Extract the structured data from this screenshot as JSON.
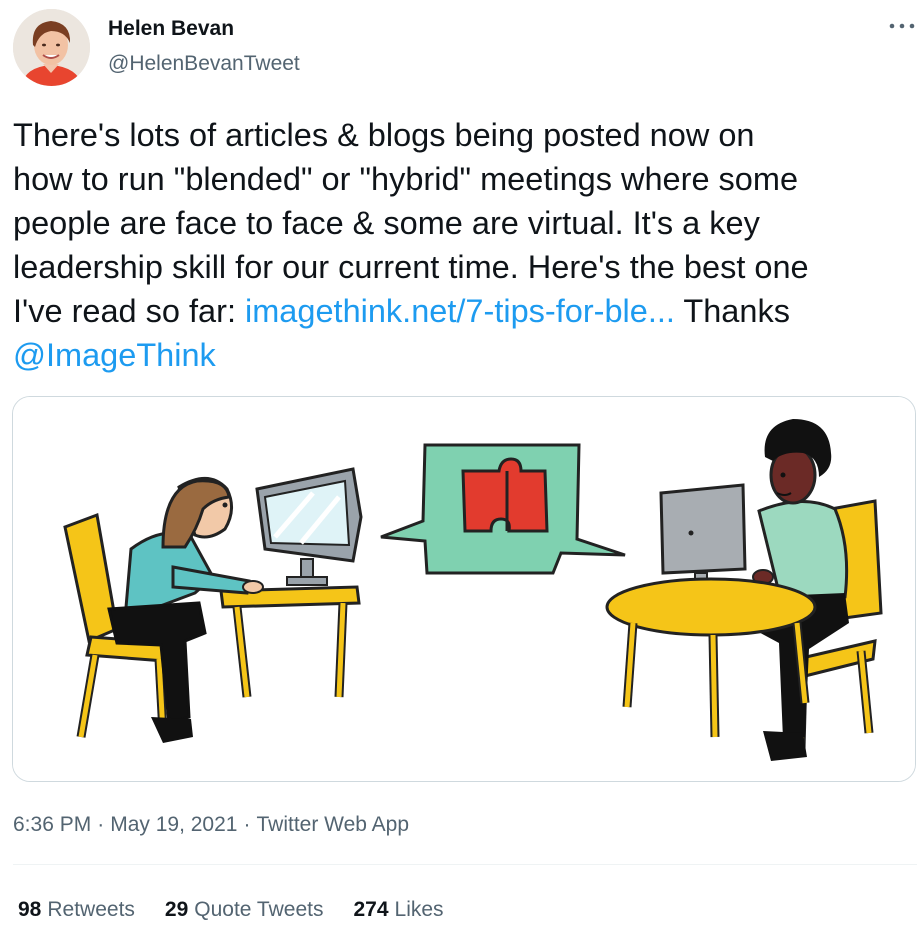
{
  "author": {
    "name": "Helen Bevan",
    "handle": "@HelenBevanTweet"
  },
  "tweet": {
    "lines": [
      "There's lots of articles & blogs being posted now on",
      "how to run \"blended\" or \"hybrid\" meetings where some",
      "people are face to face & some are virtual. It's a key",
      "leadership skill for our current time. Here's the best one"
    ],
    "line5_prefix": "I've read so far: ",
    "link_text": "imagethink.net/7-tips-for-ble...",
    "line5_suffix": " Thanks",
    "mention": "@ImageThink"
  },
  "media": {
    "icons": [
      "woman-at-computer",
      "speech-bubble-puzzle",
      "man-at-round-table"
    ]
  },
  "meta": {
    "time": "6:36 PM",
    "separator": "·",
    "date": "May 19, 2021",
    "source": "Twitter Web App"
  },
  "stats": {
    "retweets_count": "98",
    "retweets_label": "Retweets",
    "quotes_count": "29",
    "quotes_label": "Quote Tweets",
    "likes_count": "274",
    "likes_label": "Likes"
  },
  "colors": {
    "link": "#1d9bf0",
    "secondary_text": "#536471",
    "primary_text": "#0f1419",
    "border": "#cfd9de"
  }
}
